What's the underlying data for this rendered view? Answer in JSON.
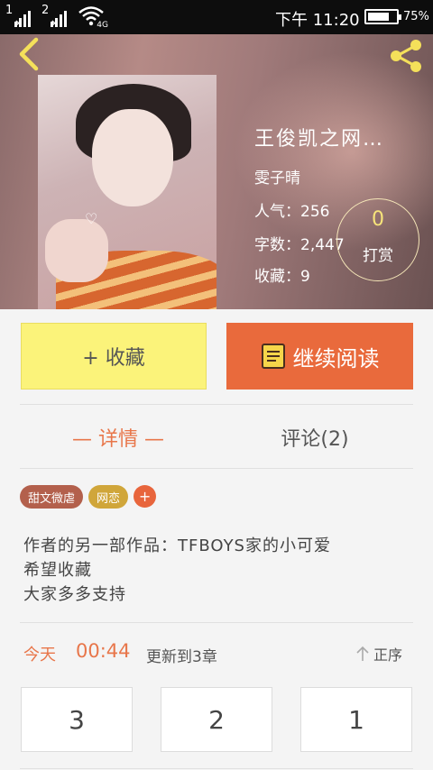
{
  "status_bar": {
    "sim1": "1",
    "sim2": "2",
    "network": "4G",
    "time": "下午 11:20",
    "battery_percent": 75,
    "battery_label": "75%"
  },
  "book": {
    "title": "王俊凯之网…",
    "author": "雯子晴",
    "stats": {
      "popularity": "人气：256",
      "word_count": "字数：2,447",
      "favorites": "收藏：9"
    },
    "reward": {
      "count": "0",
      "label": "打赏"
    }
  },
  "actions": {
    "favorite_label": "+ 收藏",
    "continue_label": "继续阅读"
  },
  "tabs": {
    "detail_label": "— 详情 —",
    "comments_label": "评论(2)"
  },
  "tags": [
    {
      "label": "甜文微虐",
      "color": "#b3604c"
    },
    {
      "label": "网恋",
      "color": "#d0a63a"
    }
  ],
  "tag_add": "+",
  "description": [
    "作者的另一部作品：TFBOYS家的小可爱",
    "希望收藏",
    "大家多多支持"
  ],
  "update": {
    "today": "今天",
    "time": "00:44",
    "text": "更新到3章",
    "order_label": "正序"
  },
  "chapters": [
    "3",
    "2",
    "1"
  ],
  "colors": {
    "accent": "#e8764a",
    "favorite_bg": "#fbf37a",
    "continue_bg": "#e96a3c"
  },
  "icons": {
    "back": "chevron-left-icon",
    "share": "share-icon",
    "book": "book-icon",
    "order": "arrow-up-icon"
  }
}
